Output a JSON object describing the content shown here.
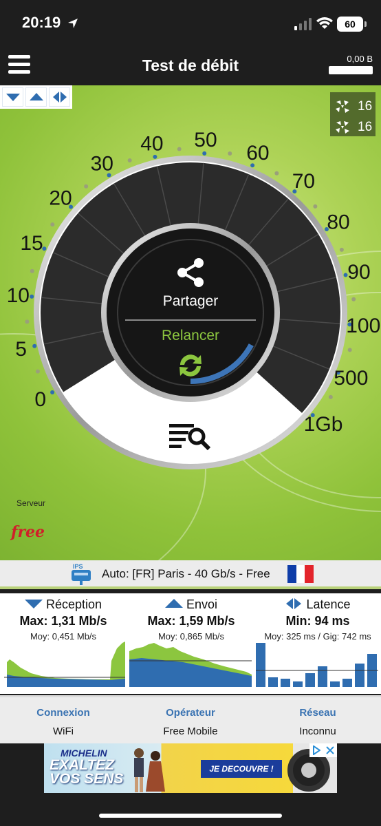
{
  "status_bar": {
    "time": "20:19",
    "battery": "60"
  },
  "header": {
    "title": "Test de débit",
    "data_usage": "0,00 B"
  },
  "peers": {
    "count_1": "16",
    "count_2": "16"
  },
  "gauge": {
    "ticks": [
      "0",
      "5",
      "10",
      "15",
      "20",
      "30",
      "40",
      "50",
      "60",
      "70",
      "80",
      "90",
      "100",
      "500",
      "1Gb"
    ],
    "share_label": "Partager",
    "relaunch_label": "Relancer"
  },
  "server": {
    "label": "Serveur",
    "logo_text": "free",
    "ips_tag": "IPS",
    "name": "Auto: [FR] Paris - 40 Gb/s - Free"
  },
  "stats": {
    "reception": {
      "title": "Réception",
      "max": "Max: 1,31 Mb/s",
      "avg": "Moy: 0,451 Mb/s"
    },
    "envoi": {
      "title": "Envoi",
      "max": "Max: 1,59 Mb/s",
      "avg": "Moy: 0,865 Mb/s"
    },
    "latence": {
      "title": "Latence",
      "min": "Min: 94 ms",
      "avg": "Moy: 325 ms / Gig: 742 ms"
    }
  },
  "info": {
    "connexion": {
      "label": "Connexion",
      "value": "WiFi"
    },
    "operateur": {
      "label": "Opérateur",
      "value": "Free Mobile"
    },
    "reseau": {
      "label": "Réseau",
      "value": "Inconnu"
    }
  },
  "ad": {
    "brand": "MICHELIN",
    "headline_1": "EXALTEZ",
    "headline_2": "VOS SENS",
    "cta": "JE DECOUVRE !"
  },
  "colors": {
    "accent_blue": "#2f6db0",
    "green": "#8cc63f",
    "dark": "#1e1e1e"
  }
}
